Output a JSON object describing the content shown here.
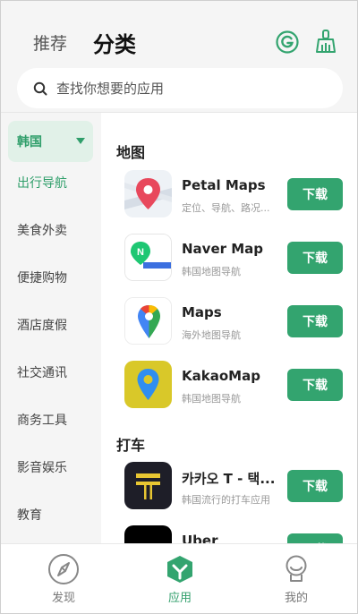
{
  "header": {
    "tab_recommend": "推荐",
    "tab_category": "分类",
    "search_placeholder": "查找你想要的应用"
  },
  "sidebar": {
    "country": "韩国",
    "items": [
      {
        "label": "出行导航",
        "active": true
      },
      {
        "label": "美食外卖",
        "active": false
      },
      {
        "label": "便捷购物",
        "active": false
      },
      {
        "label": "酒店度假",
        "active": false
      },
      {
        "label": "社交通讯",
        "active": false
      },
      {
        "label": "商务工具",
        "active": false
      },
      {
        "label": "影音娱乐",
        "active": false
      },
      {
        "label": "教育",
        "active": false
      }
    ]
  },
  "sections": [
    {
      "title": "地图",
      "apps": [
        {
          "name": "Petal Maps",
          "desc": "定位、导航、路况...",
          "button": "下载",
          "icon": "petal-maps-icon"
        },
        {
          "name": "Naver Map",
          "desc": "韩国地图导航",
          "button": "下载",
          "icon": "naver-map-icon"
        },
        {
          "name": "Maps",
          "desc": "海外地图导航",
          "button": "下载",
          "icon": "google-maps-icon"
        },
        {
          "name": "KakaoMap",
          "desc": "韩国地图导航",
          "button": "下载",
          "icon": "kakaomap-icon"
        }
      ]
    },
    {
      "title": "打车",
      "apps": [
        {
          "name": "카카오 T - 택...",
          "desc": "韩国流行的打车应用",
          "button": "下载",
          "icon": "kakao-t-icon"
        },
        {
          "name": "Uber",
          "desc": "",
          "button": "下载",
          "icon": "uber-icon"
        }
      ]
    }
  ],
  "bottom_nav": [
    {
      "label": "发现",
      "icon": "compass-icon",
      "active": false
    },
    {
      "label": "应用",
      "icon": "apps-cube-icon",
      "active": true
    },
    {
      "label": "我的",
      "icon": "profile-icon",
      "active": false
    }
  ],
  "colors": {
    "accent": "#33a46f",
    "accent_text": "#2f9e6a",
    "country_bg": "#e1f1e8"
  }
}
